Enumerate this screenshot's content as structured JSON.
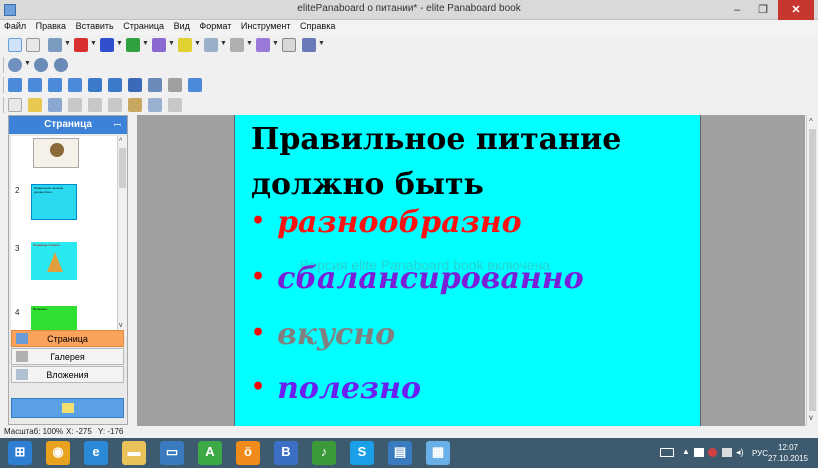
{
  "window": {
    "title": "elitePanaboard о питании* - elite Panaboard book",
    "min_label": "–",
    "max_label": "❐",
    "close_label": "✕"
  },
  "menu": [
    "Файл",
    "Правка",
    "Вставить",
    "Страница",
    "Вид",
    "Формат",
    "Инструмент",
    "Справка"
  ],
  "toolbar_icons": {
    "row1": [
      "select-arrow-icon",
      "eraser-icon",
      "pen-icon",
      "red-pen-icon",
      "blue-pen-icon",
      "green-pen-icon",
      "stamp-icon",
      "highlighter-icon",
      "shape-icon",
      "line-icon",
      "fill-icon",
      "layout-icon",
      "text-icon"
    ],
    "row2": [
      "zoom-icon",
      "zoom-in-icon",
      "zoom-out-icon"
    ],
    "row3": [
      "capture-icon",
      "folder-icon",
      "import-icon",
      "screen-icon",
      "photo-icon",
      "media-icon",
      "board-icon",
      "scanner-icon",
      "settings-icon",
      "share-icon"
    ],
    "row4": [
      "new-page-icon",
      "open-icon",
      "save-icon",
      "cut-icon",
      "copy-icon",
      "delete-icon",
      "paste-icon",
      "undo-icon",
      "redo-icon"
    ]
  },
  "sidebar": {
    "header": "Страница",
    "pin": "ꟷ",
    "thumbs": [
      {
        "num": "",
        "title": ""
      },
      {
        "num": "2",
        "title": "Правильное питание должно быть"
      },
      {
        "num": "3",
        "title": "Пирамида питания"
      },
      {
        "num": "4",
        "title": "Витамины"
      }
    ],
    "tabs": [
      {
        "label": "Страница"
      },
      {
        "label": "Галерея"
      },
      {
        "label": "Вложения"
      }
    ]
  },
  "slide": {
    "title": "Правильное питание должно быть",
    "bullets": [
      {
        "text": "разнообразно",
        "color": "#ff1010"
      },
      {
        "text": "сбалансированно",
        "color": "#7a1fd8"
      },
      {
        "text": "вкусно",
        "color": "#808080"
      },
      {
        "text": "полезно",
        "color": "#6a1ff0"
      }
    ],
    "bullet_symbol": "•",
    "watermark": "Версия elite Panaboard book включена"
  },
  "status": {
    "scale": "Масштаб: 100%",
    "x": "X: -275",
    "y": "Y: -176"
  },
  "taskbar": {
    "apps": [
      {
        "name": "start-button",
        "glyph": "⊞",
        "color": "#2d7dd2"
      },
      {
        "name": "chrome-icon",
        "glyph": "◉",
        "color": "#e9a21d"
      },
      {
        "name": "ie-icon",
        "glyph": "e",
        "color": "#2a8ad8"
      },
      {
        "name": "explorer-icon",
        "glyph": "▬",
        "color": "#e9c25a"
      },
      {
        "name": "monitor-icon",
        "glyph": "▭",
        "color": "#3a7bc0"
      },
      {
        "name": "a-app-icon",
        "glyph": "A",
        "color": "#3ba946"
      },
      {
        "name": "ok-icon",
        "glyph": "ö",
        "color": "#f08a1a"
      },
      {
        "name": "b-app-icon",
        "glyph": "B",
        "color": "#3b6fc4"
      },
      {
        "name": "music-icon",
        "glyph": "♪",
        "color": "#3a9a3a"
      },
      {
        "name": "skype-icon",
        "glyph": "S",
        "color": "#1aa0e8"
      },
      {
        "name": "document-icon",
        "glyph": "▤",
        "color": "#3a7bc0"
      },
      {
        "name": "panaboard-icon",
        "glyph": "▦",
        "color": "#6ab0e8"
      }
    ],
    "lang": "РУС",
    "time": "12:07",
    "date": "27.10.2015"
  }
}
